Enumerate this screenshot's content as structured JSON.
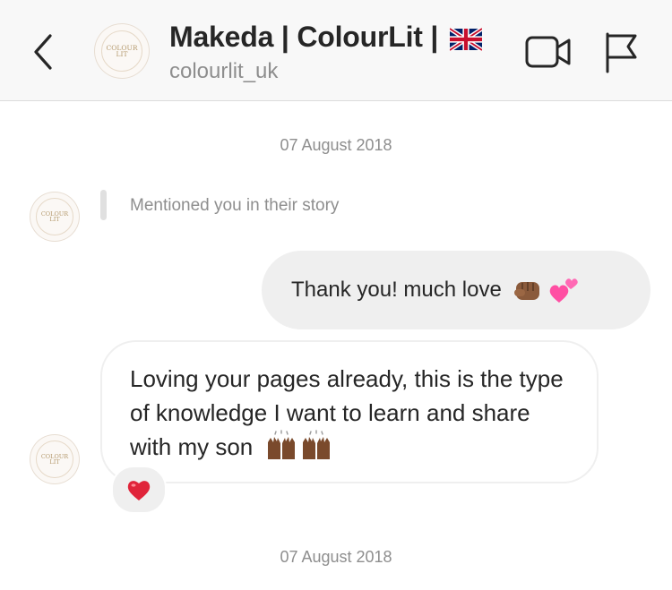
{
  "header": {
    "title": "Makeda | ColourLit |",
    "username": "colourlit_uk",
    "avatar_text_line1": "COLOUR",
    "avatar_text_line2": "LIT",
    "icons": [
      "back-chevron-icon",
      "uk-flag-emoji",
      "video-call-icon",
      "report-flag-icon"
    ]
  },
  "thread": {
    "date_1": "07 August 2018",
    "story_mention": "Mentioned you in their story",
    "outgoing_message": "Thank you! much love",
    "outgoing_emojis": [
      "fist-emoji",
      "two-hearts-emoji"
    ],
    "incoming_message": "Loving your pages already, this is the type of knowledge I want to learn and share with my son",
    "incoming_emojis": [
      "raised-hands-emoji",
      "raised-hands-emoji"
    ],
    "reaction": "heart-emoji",
    "date_2": "07 August 2018"
  },
  "colors": {
    "header_bg": "#f8f8f8",
    "bubble_grey": "#efefef",
    "secondary_text": "#8e8e8e",
    "primary_text": "#262626",
    "heart_red": "#e0243a",
    "skin_tone": "#8a5a3b"
  }
}
